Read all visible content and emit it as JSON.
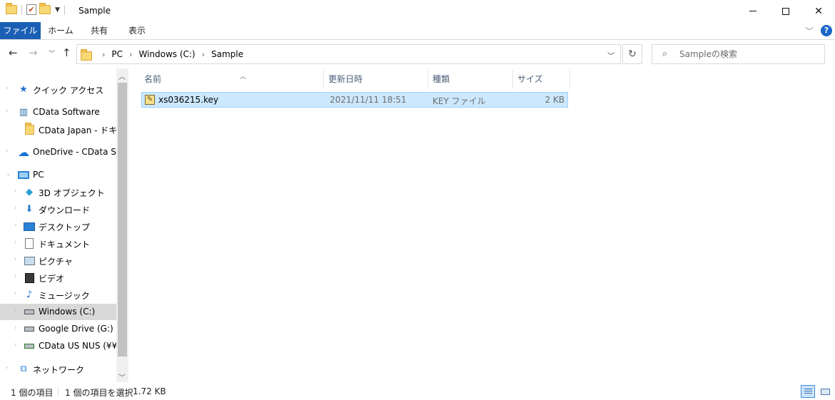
{
  "window": {
    "title": "Sample",
    "controls": {
      "minimize": "",
      "maximize": "",
      "close": "✕"
    }
  },
  "ribbon": {
    "tabs": [
      "ファイル",
      "ホーム",
      "共有",
      "表示"
    ],
    "help": "?"
  },
  "nav": {
    "breadcrumb": [
      "PC",
      "Windows (C:)",
      "Sample"
    ],
    "search_placeholder": "Sampleの検索"
  },
  "sidebar": {
    "items": [
      {
        "label": "クイック アクセス",
        "icon": "star-icon",
        "level": 0
      },
      {
        "label": "CData Software",
        "icon": "building-icon",
        "level": 0
      },
      {
        "label": "CData Japan - ドキュメ",
        "icon": "folder-icon",
        "level": 1
      },
      {
        "label": "OneDrive - CData Softv",
        "icon": "cloud-icon",
        "level": 0
      },
      {
        "label": "PC",
        "icon": "computer-icon",
        "level": 0
      },
      {
        "label": "3D オブジェクト",
        "icon": "cube-icon",
        "level": 1
      },
      {
        "label": "ダウンロード",
        "icon": "download-icon",
        "level": 1
      },
      {
        "label": "デスクトップ",
        "icon": "desktop-icon",
        "level": 1
      },
      {
        "label": "ドキュメント",
        "icon": "document-icon",
        "level": 1
      },
      {
        "label": "ピクチャ",
        "icon": "picture-icon",
        "level": 1
      },
      {
        "label": "ビデオ",
        "icon": "video-icon",
        "level": 1
      },
      {
        "label": "ミュージック",
        "icon": "music-icon",
        "level": 1
      },
      {
        "label": "Windows (C:)",
        "icon": "drive-icon",
        "level": 1,
        "selected": true
      },
      {
        "label": "Google Drive (G:)",
        "icon": "drive-icon",
        "level": 1
      },
      {
        "label": "CData US NUS (¥¥ma",
        "icon": "network-drive-icon",
        "level": 1
      },
      {
        "label": "ネットワーク",
        "icon": "network-icon",
        "level": 0
      }
    ]
  },
  "list": {
    "columns": {
      "name": "名前",
      "date": "更新日時",
      "type": "種類",
      "size": "サイズ"
    },
    "rows": [
      {
        "name": "xs036215.key",
        "date": "2021/11/11 18:51",
        "type": "KEY ファイル",
        "size": "2 KB",
        "selected": true
      }
    ]
  },
  "status": {
    "count": "1 個の項目",
    "selection": "1 個の項目を選択",
    "size": "1.72 KB"
  },
  "colors": {
    "accent": "#1a5fb4",
    "selection": "#cce8ff",
    "selection_border": "#99d1ff",
    "sidebar_selected": "#d9d9d9"
  }
}
